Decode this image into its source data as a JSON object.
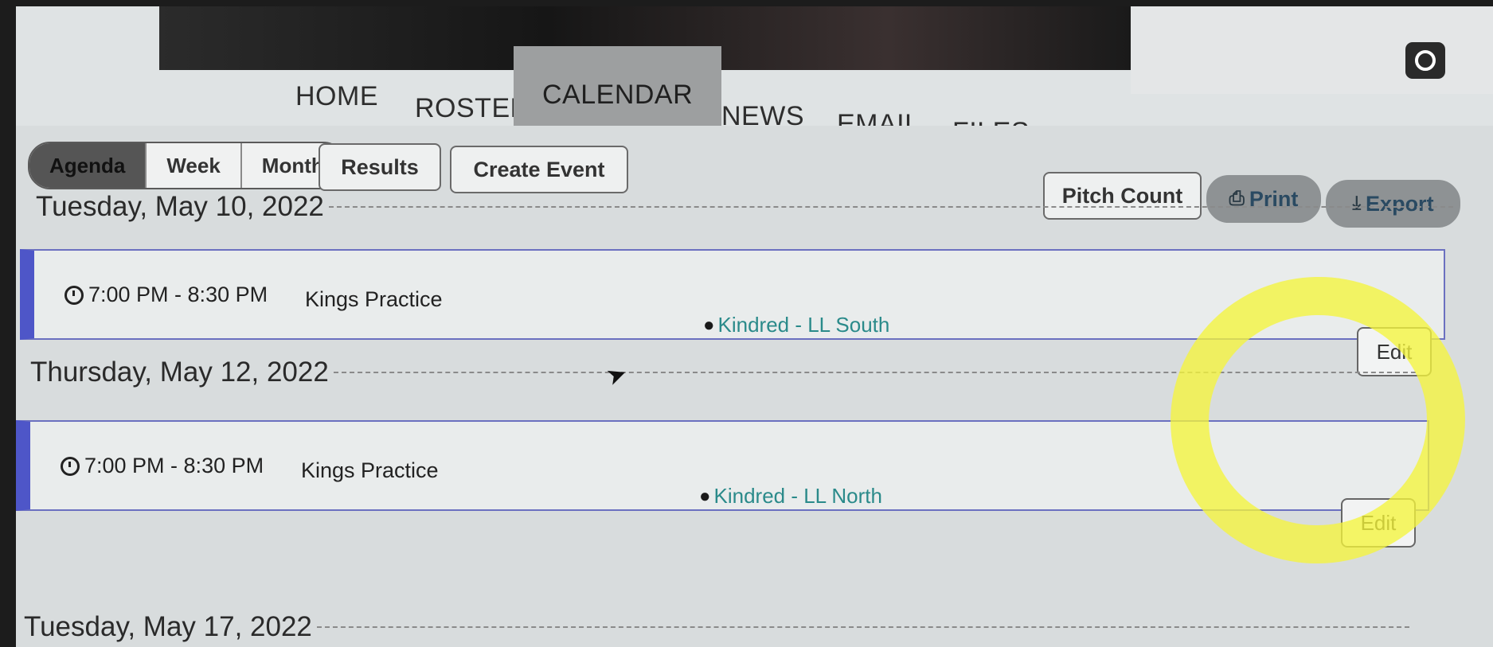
{
  "nav": {
    "tabs": [
      {
        "label": "HOME"
      },
      {
        "label": "ROSTER"
      },
      {
        "label": "CALENDAR",
        "active": true
      },
      {
        "label": "NEWS"
      },
      {
        "label": "EMAIL"
      },
      {
        "label": "FILES"
      }
    ]
  },
  "view_toggle": {
    "agenda": "Agenda",
    "week": "Week",
    "month": "Month",
    "selected": "Agenda"
  },
  "toolbar": {
    "results": "Results",
    "create_event": "Create Event",
    "pitch_count": "Pitch Count",
    "print": "Print",
    "export": "Export"
  },
  "icons": {
    "print": "printer-icon",
    "export": "download-icon",
    "time": "clock-icon",
    "location": "map-pin-icon",
    "camera": "camera-icon",
    "cursor": "mouse-cursor-icon"
  },
  "colors": {
    "event_accent": "#4e56c8",
    "location_text": "#2a8a8a",
    "active_tab": "#9d9fa0",
    "highlight": "#f5f53c"
  },
  "agenda": [
    {
      "date": "Tuesday, May 10, 2022",
      "events": [
        {
          "time": "7:00 PM - 8:30 PM",
          "title": "Kings Practice",
          "location": "Kindred - LL South",
          "edit": "Edit"
        }
      ]
    },
    {
      "date": "Thursday, May 12, 2022",
      "events": [
        {
          "time": "7:00 PM - 8:30 PM",
          "title": "Kings Practice",
          "location": "Kindred - LL North",
          "edit": "Edit"
        }
      ]
    },
    {
      "date": "Tuesday, May 17, 2022",
      "events": []
    }
  ]
}
